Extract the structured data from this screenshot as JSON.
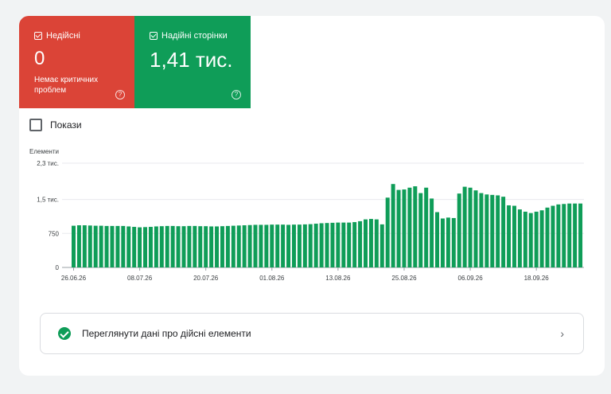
{
  "tiles": {
    "invalid": {
      "label": "Недійсні",
      "value": "0",
      "sub": "Немає критичних проблем",
      "color": "#db4437"
    },
    "valid": {
      "label": "Надійні сторінки",
      "value": "1,41 тис.",
      "color": "#0f9d58"
    }
  },
  "impressions_label": "Покази",
  "link_text": "Переглянути дані про дійсні елементи",
  "chart_data": {
    "type": "bar",
    "ylabel": "Елементи",
    "ylim": [
      0,
      2300
    ],
    "yticks": [
      {
        "v": 0,
        "label": "0"
      },
      {
        "v": 750,
        "label": "750"
      },
      {
        "v": 1500,
        "label": "1,5 тис."
      },
      {
        "v": 2300,
        "label": "2,3 тис."
      }
    ],
    "xticks": [
      {
        "i": 0,
        "label": "26.06.26"
      },
      {
        "i": 12,
        "label": "08.07.26"
      },
      {
        "i": 24,
        "label": "20.07.26"
      },
      {
        "i": 36,
        "label": "01.08.26"
      },
      {
        "i": 48,
        "label": "13.08.26"
      },
      {
        "i": 60,
        "label": "25.08.26"
      },
      {
        "i": 72,
        "label": "06.09.26"
      },
      {
        "i": 84,
        "label": "18.09.26"
      }
    ],
    "color": "#0f9d58",
    "values": [
      920,
      930,
      930,
      925,
      920,
      920,
      915,
      915,
      915,
      915,
      905,
      895,
      885,
      890,
      895,
      905,
      910,
      915,
      915,
      910,
      910,
      915,
      915,
      910,
      910,
      905,
      905,
      910,
      915,
      920,
      925,
      930,
      935,
      940,
      940,
      940,
      945,
      945,
      945,
      940,
      945,
      945,
      950,
      955,
      965,
      975,
      980,
      985,
      990,
      990,
      990,
      1000,
      1020,
      1060,
      1070,
      1060,
      950,
      1540,
      1840,
      1710,
      1720,
      1760,
      1790,
      1640,
      1760,
      1520,
      1220,
      1080,
      1100,
      1090,
      1630,
      1780,
      1760,
      1700,
      1640,
      1610,
      1600,
      1590,
      1560,
      1370,
      1360,
      1280,
      1230,
      1200,
      1230,
      1260,
      1320,
      1360,
      1390,
      1400,
      1410,
      1410,
      1410
    ]
  }
}
